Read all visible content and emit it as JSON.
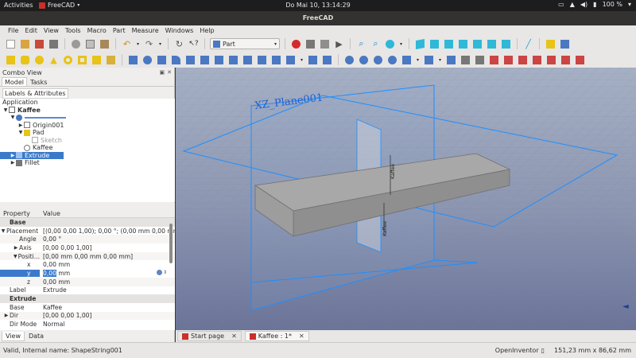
{
  "topbar": {
    "activities": "Activities",
    "app_name": "FreeCAD",
    "clock": "Do Mai 10, 13:14:29",
    "battery": "100 %"
  },
  "window": {
    "title": "FreeCAD"
  },
  "menu": [
    "File",
    "Edit",
    "View",
    "Tools",
    "Macro",
    "Part",
    "Measure",
    "Windows",
    "Help"
  ],
  "toolbar": {
    "workbench": "Part"
  },
  "combo_view": {
    "title": "Combo View",
    "tabs": [
      "Model",
      "Tasks"
    ],
    "section": "Labels & Attributes",
    "tree": {
      "root": "Application",
      "doc": "Kaffee",
      "items": [
        "Origin001",
        "Pad",
        "Sketch",
        "Kaffee",
        "Extrude",
        "Fillet"
      ]
    }
  },
  "properties": {
    "headers": [
      "Property",
      "Value"
    ],
    "groups": {
      "base": "Base",
      "extrude": "Extrude"
    },
    "rows": {
      "placement": {
        "name": "Placement",
        "value": "[(0,00 0,00 1,00); 0,00 °; (0,00 mm  0,00 mm  ..."
      },
      "angle": {
        "name": "Angle",
        "value": "0,00 °"
      },
      "axis": {
        "name": "Axis",
        "value": "[0,00 0,00 1,00]"
      },
      "position": {
        "name": "Positi...",
        "value": "[0,00 mm  0,00 mm  0,00 mm]"
      },
      "x": {
        "name": "x",
        "value": "0,00 mm"
      },
      "y": {
        "name": "y",
        "value_sel": "0,00",
        "value_unit": " mm"
      },
      "z": {
        "name": "z",
        "value": "0,00 mm"
      },
      "label": {
        "name": "Label",
        "value": "Extrude"
      },
      "base2": {
        "name": "Base",
        "value": "Kaffee"
      },
      "dir": {
        "name": "Dir",
        "value": "[0,00 0,00 1,00]"
      },
      "dirmode": {
        "name": "Dir Mode",
        "value": "Normal"
      }
    },
    "bottom_tabs": [
      "View",
      "Data"
    ]
  },
  "viewport": {
    "plane_label": "XZ_Plane001",
    "text_label_a": "Kaffee",
    "text_label_b": "Kaffee"
  },
  "doc_tabs": [
    {
      "label": "Start page"
    },
    {
      "label": "Kaffee : 1*"
    }
  ],
  "status": {
    "message": "Valid, Internal name: ShapeString001",
    "navigation": "OpenInventor",
    "dimensions": "151,23 mm x 86,62 mm"
  },
  "colors": {
    "accent": "#3b7acb",
    "plane_outline": "#1e8fff",
    "viewport_top": "#a6b0c4",
    "viewport_bottom": "#6b7498"
  }
}
